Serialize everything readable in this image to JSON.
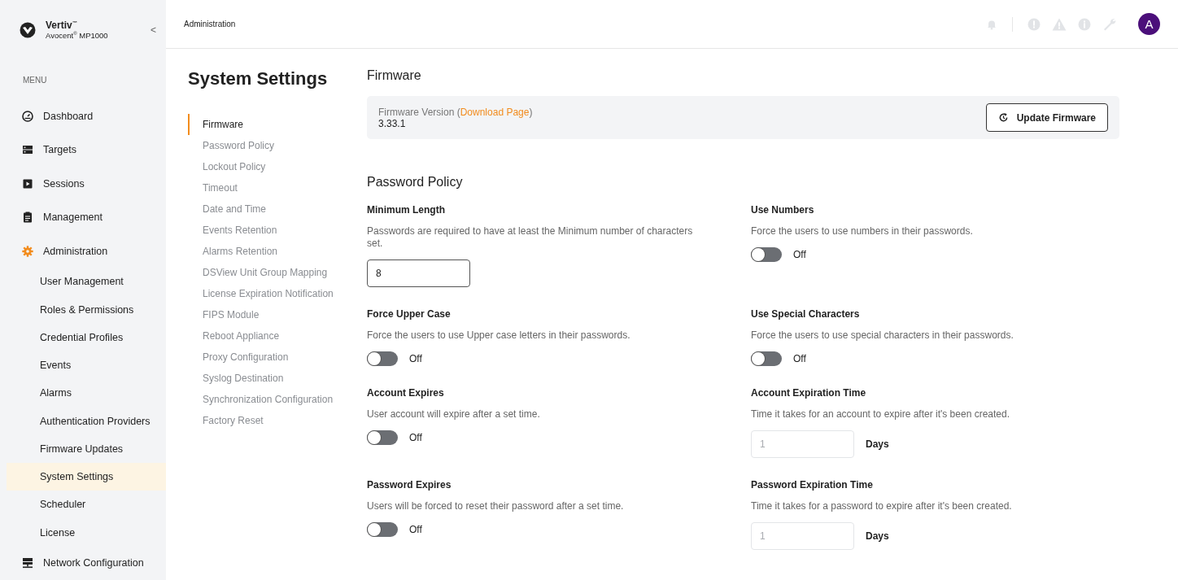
{
  "brand": {
    "name": "Vertiv",
    "name_mark": "™",
    "product": "Avocent",
    "product_mark": "®",
    "model": "MP1000",
    "collapse": "<"
  },
  "breadcrumb": "Administration",
  "user": {
    "initial": "A"
  },
  "menu": {
    "heading": "MENU",
    "items": [
      {
        "label": "Dashboard"
      },
      {
        "label": "Targets"
      },
      {
        "label": "Sessions"
      },
      {
        "label": "Management"
      },
      {
        "label": "Administration",
        "expanded": true,
        "children": [
          {
            "label": "User Management",
            "selected": false
          },
          {
            "label": "Roles & Permissions",
            "selected": false
          },
          {
            "label": "Credential Profiles",
            "selected": false
          },
          {
            "label": "Events",
            "selected": false
          },
          {
            "label": "Alarms",
            "selected": false
          },
          {
            "label": "Authentication Providers",
            "selected": false
          },
          {
            "label": "Firmware Updates",
            "selected": false
          },
          {
            "label": "System Settings",
            "selected": true
          },
          {
            "label": "Scheduler",
            "selected": false
          },
          {
            "label": "License",
            "selected": false
          }
        ]
      },
      {
        "label": "Network Configuration"
      }
    ]
  },
  "page_title": "System Settings",
  "sections_nav": [
    {
      "label": "Firmware",
      "selected": true
    },
    {
      "label": "Password Policy",
      "selected": false
    },
    {
      "label": "Lockout Policy",
      "selected": false
    },
    {
      "label": "Timeout",
      "selected": false
    },
    {
      "label": "Date and Time",
      "selected": false
    },
    {
      "label": "Events Retention",
      "selected": false
    },
    {
      "label": "Alarms Retention",
      "selected": false
    },
    {
      "label": "DSView Unit Group Mapping",
      "selected": false
    },
    {
      "label": "License Expiration Notification",
      "selected": false
    },
    {
      "label": "FIPS Module",
      "selected": false
    },
    {
      "label": "Reboot Appliance",
      "selected": false
    },
    {
      "label": "Proxy Configuration",
      "selected": false
    },
    {
      "label": "Syslog Destination",
      "selected": false
    },
    {
      "label": "Synchronization Configuration",
      "selected": false
    },
    {
      "label": "Factory Reset",
      "selected": false
    }
  ],
  "firmware": {
    "heading": "Firmware",
    "label_before": "Firmware Version (",
    "link": "Download Page",
    "label_after": ")",
    "version": "3.33.1",
    "button": "Update Firmware"
  },
  "password_policy": {
    "heading": "Password Policy",
    "fields": [
      {
        "kind": "input",
        "title": "Minimum Length",
        "description": "Passwords are required to have at least the Minimum number of characters set.",
        "value": "8",
        "disabled": false
      },
      {
        "kind": "toggle",
        "title": "Use Numbers",
        "description": "Force the users to use numbers in their passwords.",
        "on": false,
        "state_text": "Off"
      },
      {
        "kind": "toggle",
        "title": "Force Upper Case",
        "description": "Force the users to use Upper case letters in their passwords.",
        "on": false,
        "state_text": "Off"
      },
      {
        "kind": "toggle",
        "title": "Use Special Characters",
        "description": "Force the users to use special characters in their passwords.",
        "on": false,
        "state_text": "Off"
      },
      {
        "kind": "toggle",
        "title": "Account Expires",
        "description": "User account will expire after a set time.",
        "on": false,
        "state_text": "Off"
      },
      {
        "kind": "input",
        "title": "Account Expiration Time",
        "description": "Time it takes for an account to expire after it's been created.",
        "placeholder": "1",
        "disabled": true,
        "unit": "Days"
      },
      {
        "kind": "toggle",
        "title": "Password Expires",
        "description": "Users will be forced to reset their password after a set time.",
        "on": false,
        "state_text": "Off"
      },
      {
        "kind": "input",
        "title": "Password Expiration Time",
        "description": "Time it takes for a password to expire after it's been created.",
        "placeholder": "1",
        "disabled": true,
        "unit": "Days"
      }
    ]
  }
}
